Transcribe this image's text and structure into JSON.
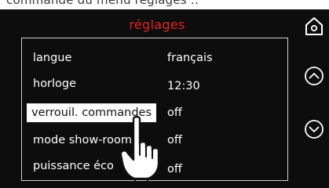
{
  "header": {
    "cropped_text": "commande du menu réglages ::",
    "title": "réglages"
  },
  "settings": [
    {
      "label": "langue",
      "value": "français"
    },
    {
      "label": "horloge",
      "value": "12:30"
    },
    {
      "label": "verrouil. commandes",
      "value": "off",
      "selected": true
    },
    {
      "label": "mode show-room",
      "value": "off"
    },
    {
      "label": "puissance éco",
      "value": "off"
    }
  ],
  "controls": {
    "home_icon": "home-icon",
    "scroll_up_icon": "chevron-up-circle-icon",
    "scroll_down_icon": "chevron-down-circle-icon"
  },
  "colors": {
    "background": "#0d0d0d",
    "title": "#e5231b",
    "text": "#ffffff",
    "selected_bg": "#ffffff",
    "selected_text": "#111111",
    "border": "#cfcfcf"
  }
}
